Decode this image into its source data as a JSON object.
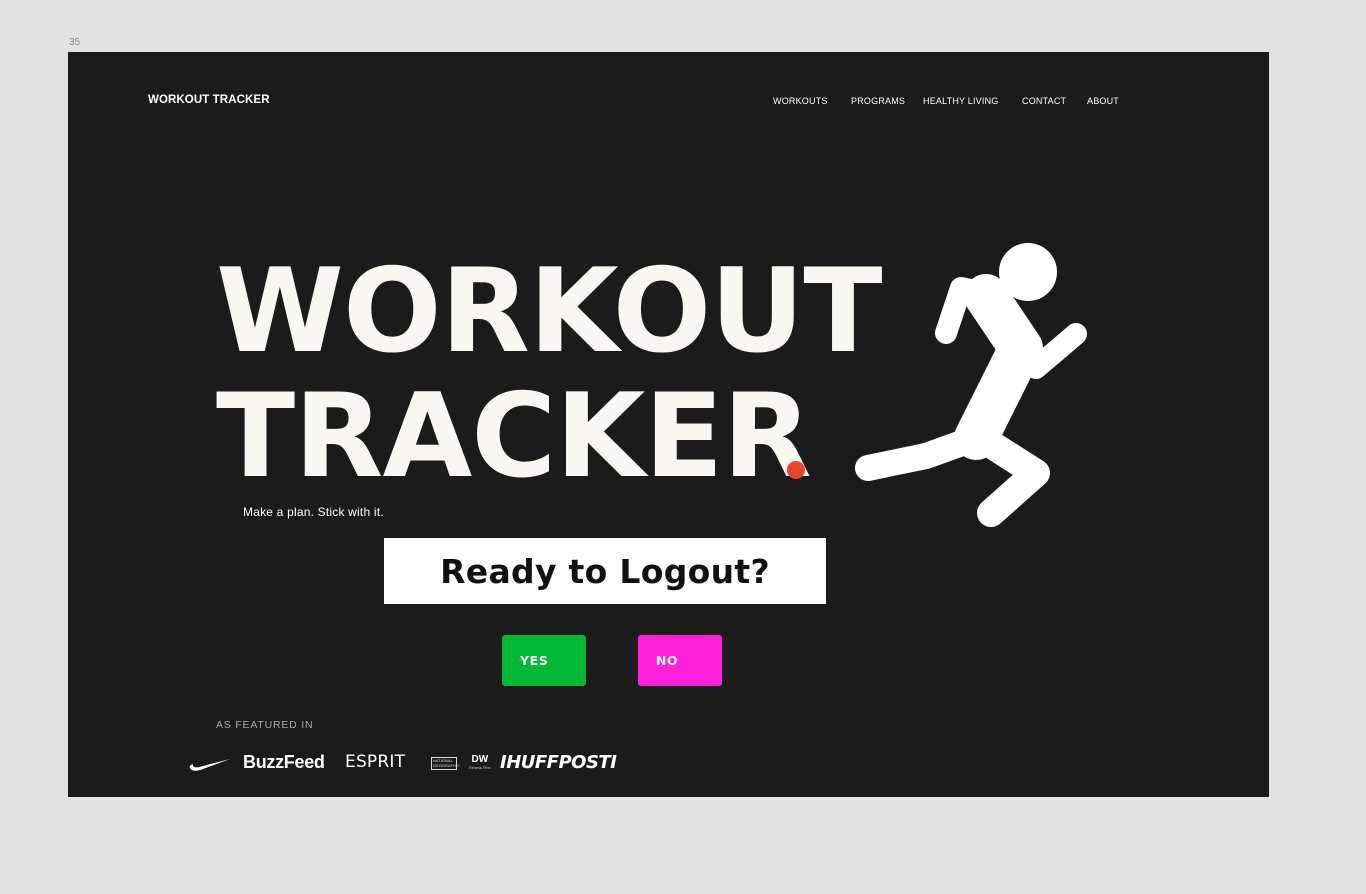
{
  "canvas": {
    "frame_label": "35"
  },
  "header": {
    "brand": "WORKOUT TRACKER",
    "nav": [
      "WORKOUTS",
      "PROGRAMS",
      "HEALTHY LIVING",
      "CONTACT",
      "ABOUT"
    ]
  },
  "hero": {
    "line1": "WORKOUT",
    "line2": "TRACKER",
    "tagline": "Make a plan. Stick with it.",
    "accent_dot_color": "#e8452c",
    "illustration_icon": "running-person-icon"
  },
  "dialog": {
    "question": "Ready to Logout?",
    "yes_label": "YES",
    "no_label": "NO",
    "yes_color": "#00b835",
    "no_color": "#ff21d9"
  },
  "featured": {
    "label": "AS FEATURED IN",
    "logos": {
      "nike": "nike-swoosh-logo",
      "buzzfeed": "BuzzFeed",
      "esprit": "ESPRIT",
      "natgeo": "NATIONAL GEOGRAPHIC",
      "dw": "DW",
      "dw_sub": "Fitness First",
      "huffpost": "IHUFFPOSTI"
    }
  },
  "colors": {
    "page_background": "#e2e2e2",
    "frame_background": "#1b1b1b",
    "hero_text": "#f8f7f1"
  }
}
